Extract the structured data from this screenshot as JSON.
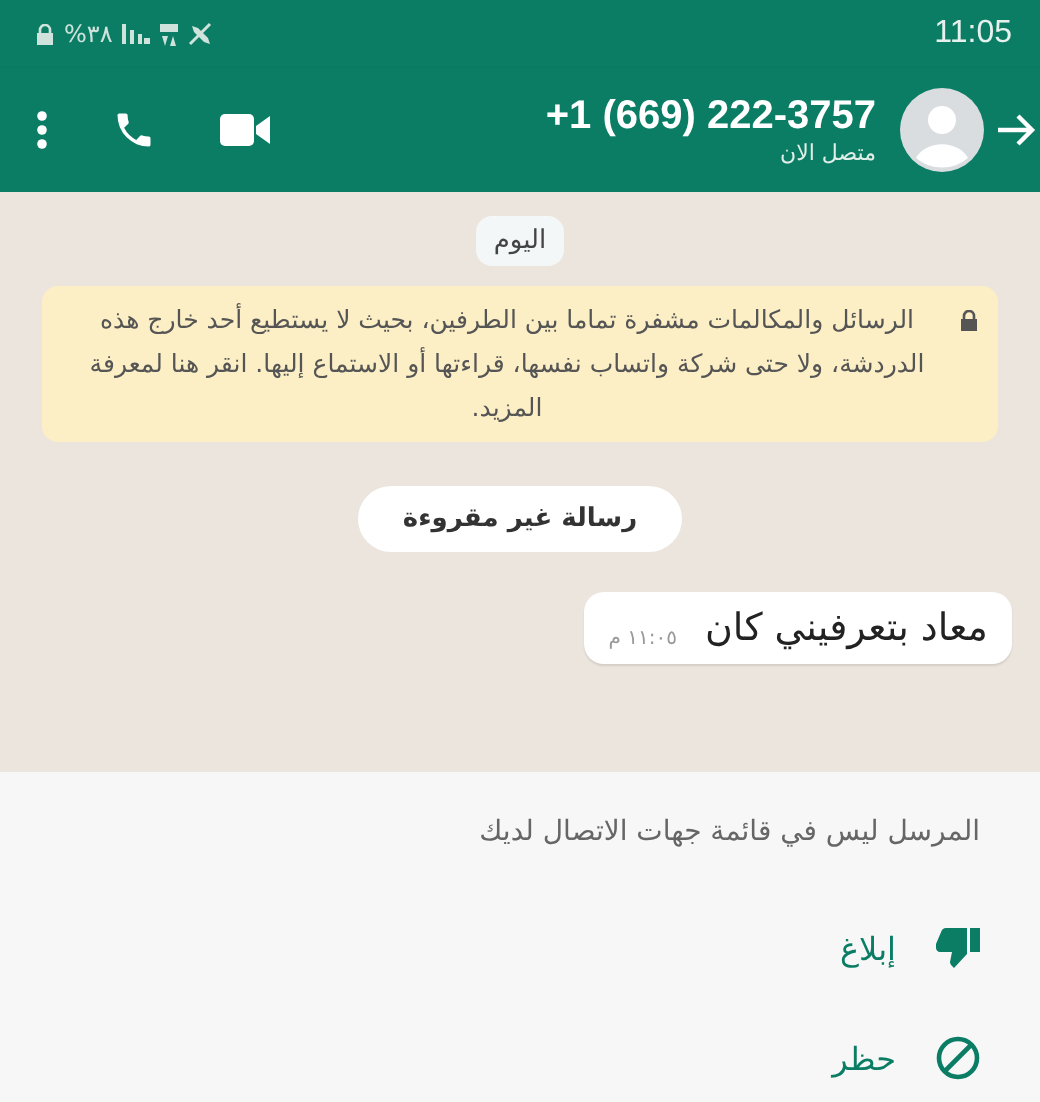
{
  "status_bar": {
    "battery": "%٣٨",
    "time": "11:05"
  },
  "header": {
    "title": "+1 (669) 222-3757",
    "subtitle": "متصل الان"
  },
  "chat": {
    "date_chip": "اليوم",
    "encryption_notice": "الرسائل والمكالمات مشفرة تماما بين الطرفين، بحيث لا يستطيع أحد خارج هذه الدردشة، ولا حتى شركة واتساب نفسها، قراءتها أو الاستماع إليها. انقر هنا لمعرفة المزيد.",
    "unread_chip": "رسالة غير مقروءة",
    "messages": [
      {
        "text": "معاد بتعرفيني كان",
        "time": "١١:٠٥ م"
      }
    ]
  },
  "unknown_sender": {
    "notice": "المرسل ليس في قائمة جهات الاتصال لديك",
    "actions": [
      {
        "kind": "report",
        "label": "إبلاغ"
      },
      {
        "kind": "block",
        "label": "حظر"
      }
    ]
  }
}
